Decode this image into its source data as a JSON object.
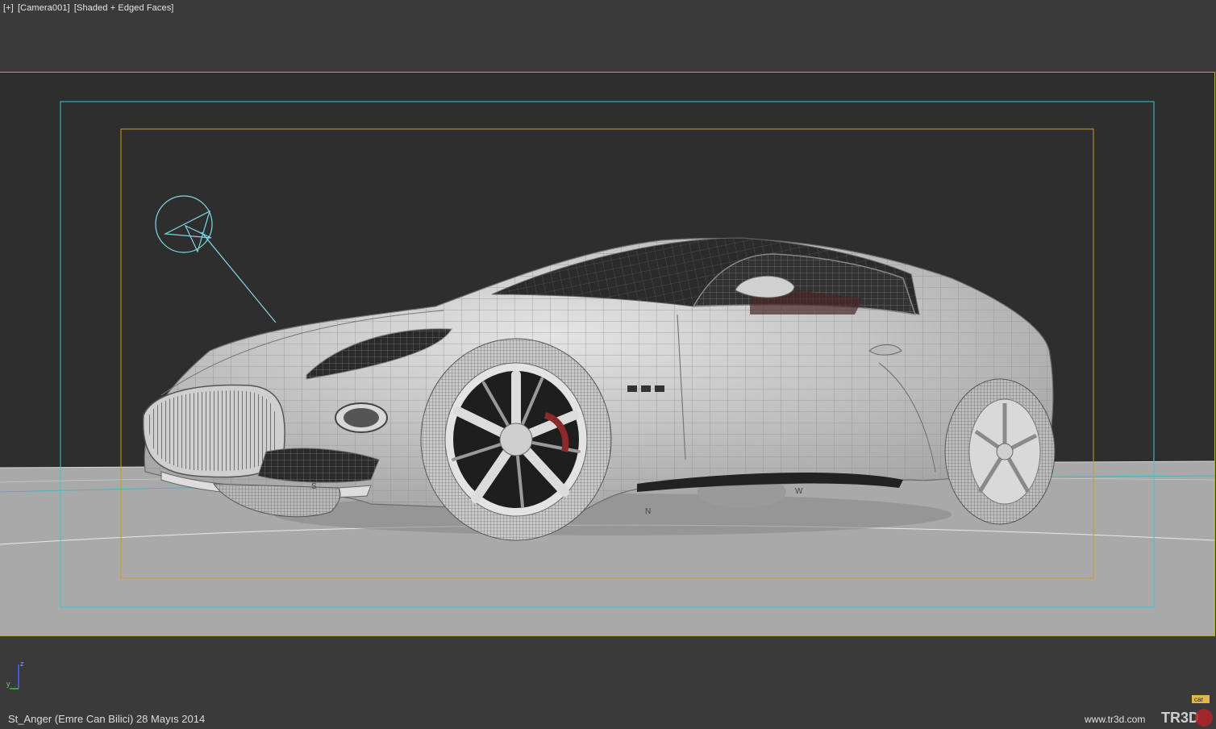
{
  "viewport": {
    "labels": [
      "[+]",
      "[Camera001]",
      "[Shaded + Edged Faces]"
    ]
  },
  "scene_labels": {
    "s": "S",
    "n": "N",
    "w": "W"
  },
  "axis": {
    "z": "z",
    "y": "y"
  },
  "footer": {
    "credit": "St_Anger (Emre Can Bilici)  28 Mayıs 2014",
    "site": "www.tr3d.com"
  },
  "logo": {
    "badge": "car",
    "text": "TR3D"
  },
  "colors": {
    "background": "#3a3a3a",
    "viewport_bg": "#2e2e2e",
    "floor": "#a9a9a9",
    "safe_frame_outer": "#b8a93a",
    "safe_frame_cyan": "#3ec4d4",
    "safe_frame_inner": "#c99a2a",
    "wire": "#6e6e6e",
    "car_body": "#c8c8c8"
  }
}
